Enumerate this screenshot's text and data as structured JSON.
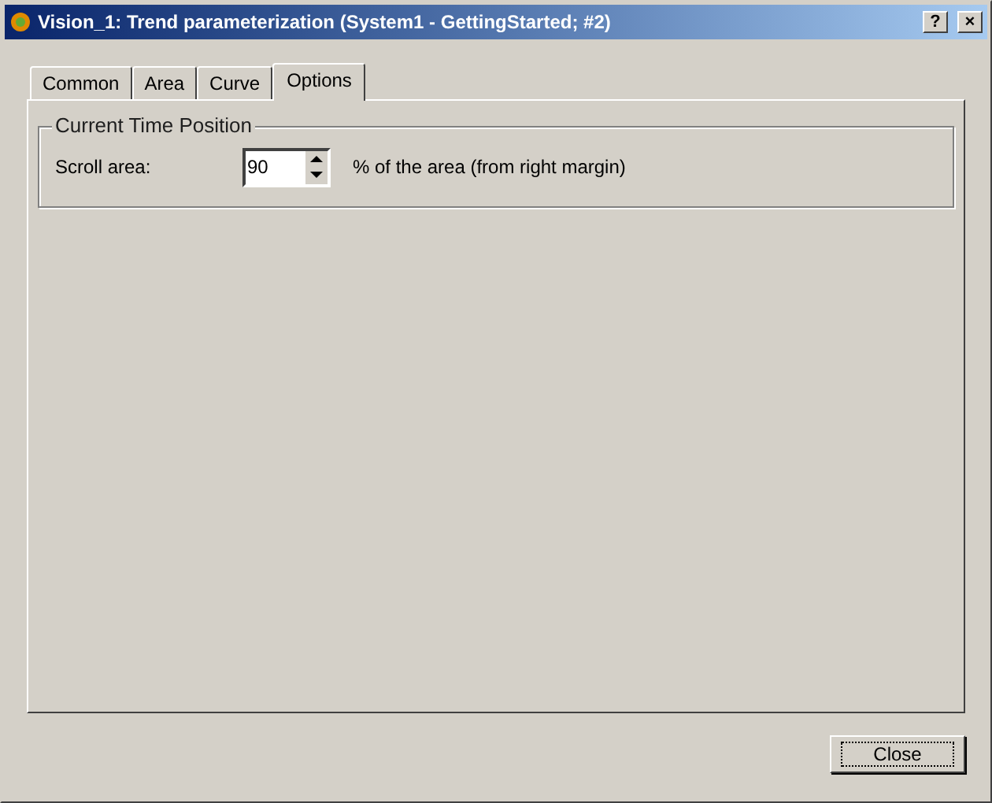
{
  "window": {
    "title": "Vision_1: Trend parameterization (System1 - GettingStarted; #2)",
    "title_buttons": [
      "?",
      "×"
    ]
  },
  "tabs": [
    {
      "label": "Common",
      "selected": false
    },
    {
      "label": "Area",
      "selected": false
    },
    {
      "label": "Curve",
      "selected": false
    },
    {
      "label": "Options",
      "selected": true
    }
  ],
  "group": {
    "title": "Current Time Position",
    "label": "Scroll area:",
    "value": "90",
    "unit": "% of the area (from right margin)"
  },
  "buttons": [
    "Close"
  ]
}
